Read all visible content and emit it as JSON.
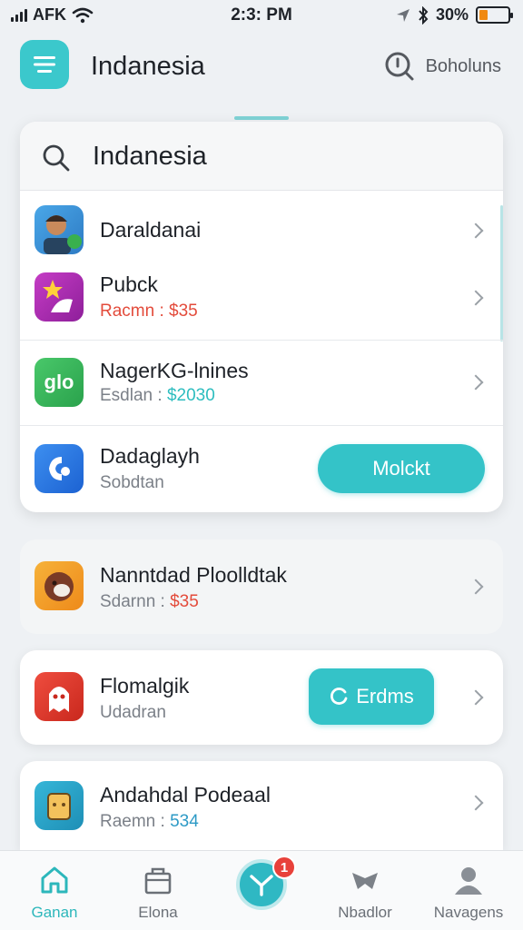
{
  "status_bar": {
    "carrier": "AFK",
    "time": "2:3: PM",
    "battery": "30%",
    "battery_level": 0.3
  },
  "header": {
    "title": "Indanesia",
    "action_label": "Boholuns",
    "menu_icon": "menu-icon",
    "action_icon": "search-icon"
  },
  "search": {
    "value": "Indanesia",
    "placeholder": ""
  },
  "results": [
    {
      "title": "Daraldanai",
      "subtitle": ""
    },
    {
      "title": "Pubck",
      "subtitle": "Racmn : $35"
    },
    {
      "title": "NagerKG-lnines",
      "subtitle": "Esdlan : $2030",
      "icon_text": "glo"
    },
    {
      "title": "Dadaglayh",
      "subtitle": "Sobdtan",
      "button": "Molckt"
    }
  ],
  "cards": [
    {
      "title": "Nanntdad Ploolldtak",
      "subtitle": "Sdarnn : $35"
    },
    {
      "title": "Flomalgik",
      "subtitle": "Udadran",
      "button": "Erdms"
    },
    {
      "title": "Andahdal Podeaal",
      "subtitle": "Raemn : 534"
    }
  ],
  "bottom_nav": [
    {
      "label": "Ganan",
      "icon": "home-icon",
      "active": true
    },
    {
      "label": "Elona",
      "icon": "bag-icon",
      "active": false
    },
    {
      "label": "",
      "icon": "center-action-icon",
      "badge": "1"
    },
    {
      "label": "Nbadlor",
      "icon": "shield-icon",
      "active": false
    },
    {
      "label": "Navagens",
      "icon": "profile-icon",
      "active": false
    }
  ],
  "colors": {
    "accent": "#34c3c8",
    "price_red": "#e34b3b",
    "badge": "#e8413a",
    "battery": "#f08a12"
  }
}
